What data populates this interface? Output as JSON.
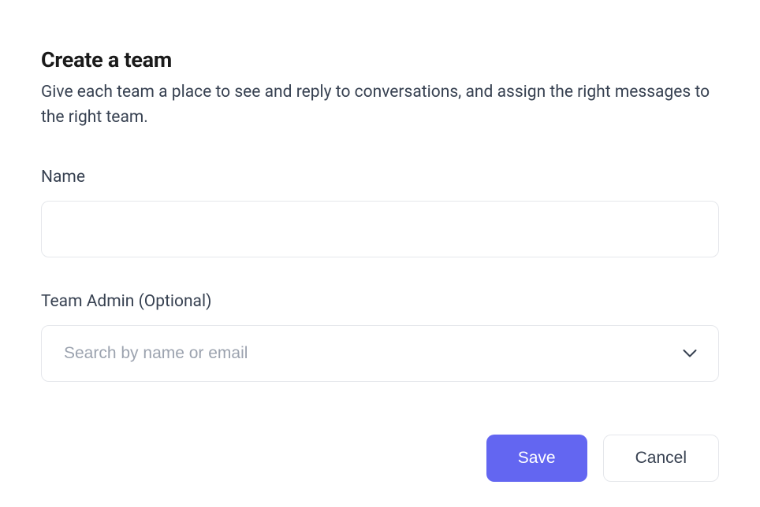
{
  "modal": {
    "title": "Create a team",
    "subtitle": "Give each team a place to see and reply to conversations, and assign the right messages to the right team."
  },
  "fields": {
    "name": {
      "label": "Name",
      "value": "",
      "placeholder": ""
    },
    "team_admin": {
      "label": "Team Admin (Optional)",
      "placeholder": "Search by name or email",
      "value": ""
    }
  },
  "buttons": {
    "save": "Save",
    "cancel": "Cancel"
  },
  "colors": {
    "primary": "#6366f1",
    "text": "#1f2937",
    "muted": "#374151",
    "placeholder": "#9ca3af",
    "border": "#e5e7eb"
  }
}
